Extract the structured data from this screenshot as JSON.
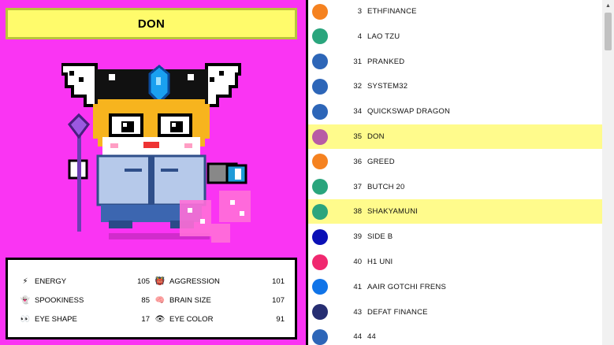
{
  "pet": {
    "name": "DON"
  },
  "stats": [
    {
      "icon": "lightning-icon",
      "glyph": "⚡",
      "label": "ENERGY",
      "value": "105"
    },
    {
      "icon": "ghost-icon",
      "glyph": "👻",
      "label": "SPOOKINESS",
      "value": "85"
    },
    {
      "icon": "eyes-icon",
      "glyph": "👀",
      "label": "EYE SHAPE",
      "value": "17"
    },
    {
      "icon": "devil-icon",
      "glyph": "👹",
      "label": "AGGRESSION",
      "value": "101"
    },
    {
      "icon": "brain-icon",
      "glyph": "🧠",
      "label": "BRAIN SIZE",
      "value": "107"
    },
    {
      "icon": "eye-icon",
      "glyph": "👁",
      "label": "EYE COLOR",
      "value": "91"
    }
  ],
  "list": [
    {
      "num": "3",
      "name": "ETHFINANCE",
      "color": "#f58220"
    },
    {
      "num": "4",
      "name": "LAO TZU",
      "color": "#2aa57d"
    },
    {
      "num": "31",
      "name": "PRANKED",
      "color": "#2d66b8"
    },
    {
      "num": "32",
      "name": "SYSTEM32",
      "color": "#2d66b8"
    },
    {
      "num": "34",
      "name": "QUICKSWAP DRAGON",
      "color": "#2d66b8"
    },
    {
      "num": "35",
      "name": "DON",
      "color": "#b85ba5",
      "selected": true
    },
    {
      "num": "36",
      "name": "GREED",
      "color": "#f58220"
    },
    {
      "num": "37",
      "name": "BUTCH 20",
      "color": "#2aa57d"
    },
    {
      "num": "38",
      "name": "SHAKYAMUNI",
      "color": "#2aa57d",
      "selected": true
    },
    {
      "num": "39",
      "name": "SIDE B",
      "color": "#0a10b6"
    },
    {
      "num": "40",
      "name": "H1 UNI",
      "color": "#f0286f"
    },
    {
      "num": "41",
      "name": "AAIR GOTCHI FRENS",
      "color": "#1074e8"
    },
    {
      "num": "43",
      "name": "DEFAT FINANCE",
      "color": "#262e72"
    },
    {
      "num": "44",
      "name": "44",
      "color": "#2d66b8"
    }
  ],
  "scrollbar": {
    "up_arrow": "▲"
  }
}
